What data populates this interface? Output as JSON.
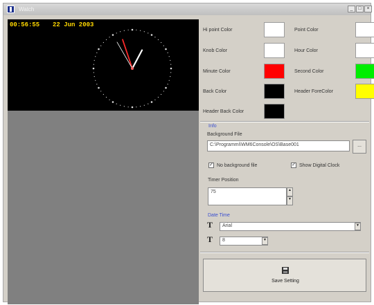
{
  "window": {
    "title": "Watch",
    "controls": [
      "_",
      "□",
      "×"
    ]
  },
  "clock": {
    "time": "00:56:55",
    "date": "22 Jun 2003",
    "face_color": "#000000",
    "tick_color": "#dddddd",
    "minute_hand_color": "#ff2a2a",
    "hour_hand_color": "#ffffff",
    "second_hand_color": "#ffffff"
  },
  "colors": {
    "hi_point_color_label": "Hi point Color",
    "hi_point_color": "#ffffff",
    "point_color_label": "Point Color",
    "point_color": "#ffffff",
    "knob_color_label": "Knob Color",
    "knob_color": "#ffffff",
    "hour_color_label": "Hour Color",
    "hour_color": "#ffffff",
    "minute_color_label": "Minute Color",
    "minute_color": "#ff0000",
    "second_color_label": "Second Color",
    "second_color": "#00ee00",
    "back_color_label": "Back Color",
    "back_color": "#000000",
    "header_fore_color_label": "Header ForeColor",
    "header_fore_color": "#ffff00",
    "header_back_color_label": "Header Back Color",
    "header_back_color": "#000000"
  },
  "info": {
    "section_label": "Info",
    "background_file_label": "Background File",
    "background_file_value": "C:\\Programmi\\WM6Console\\OS\\Base001",
    "browse_label": "...",
    "no_background_label": "No background file",
    "no_background_checked": true,
    "show_digital_label": "Show Digital Clock",
    "show_digital_checked": true,
    "timer_position_label": "Timer Position",
    "timer_position_value": "75"
  },
  "date_time": {
    "section_label": "Date Time",
    "font_value": "Arial",
    "size_value": "8"
  },
  "save": {
    "label": "Save Setting",
    "icon": "floppy-disk-icon"
  }
}
